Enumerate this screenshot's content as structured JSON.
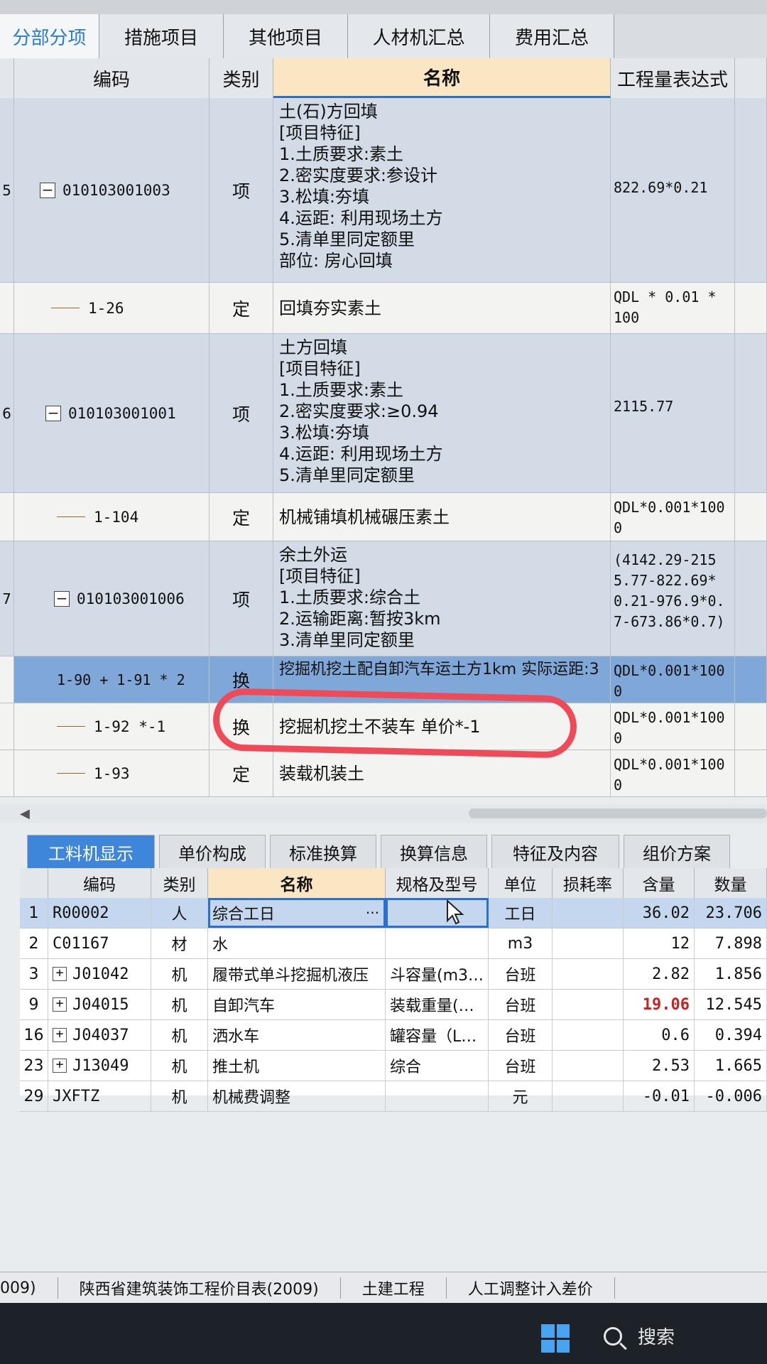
{
  "top_tabs": [
    "分部分项",
    "措施项目",
    "其他项目",
    "人材机汇总",
    "费用汇总"
  ],
  "grid_headers": {
    "code": "编码",
    "type": "类别",
    "name": "名称",
    "expr": "工程量表达式"
  },
  "rows": [
    {
      "num": "5",
      "code": "010103001003",
      "type": "项",
      "kind": "item",
      "name_lines": [
        "土(石)方回填",
        "[项目特征]",
        "1.土质要求:素土",
        "2.密实度要求:参设计",
        "3.松填:夯填",
        "4.运距: 利用现场土方",
        "5.清单里同定额里",
        "部位: 房心回填"
      ],
      "expr": "822.69*0.21"
    },
    {
      "num": "",
      "code": "1-26",
      "type": "定",
      "kind": "sub",
      "name_lines": [
        "回填夯实素土"
      ],
      "expr": "QDL * 0.01 * 100"
    },
    {
      "num": "6",
      "code": "010103001001",
      "type": "项",
      "kind": "item",
      "name_lines": [
        "土方回填",
        "[项目特征]",
        "1.土质要求:素土",
        "2.密实度要求:≥0.94",
        "3.松填:夯填",
        "4.运距: 利用现场土方",
        "5.清单里同定额里"
      ],
      "expr": "2115.77"
    },
    {
      "num": "",
      "code": "1-104",
      "type": "定",
      "kind": "sub",
      "name_lines": [
        "机械铺填机械碾压素土"
      ],
      "expr": "QDL*0.001*1000"
    },
    {
      "num": "7",
      "code": "010103001006",
      "type": "项",
      "kind": "item",
      "name_lines": [
        "余土外运",
        "[项目特征]",
        "1.土质要求:综合土",
        "2.运输距离:暂按3km",
        "3.清单里同定额里"
      ],
      "expr": "(4142.29-2155.77-822.69*0.21-976.9*0.7-673.86*0.7)"
    },
    {
      "num": "",
      "code": "1-90 + 1-91 * 2",
      "type": "换",
      "kind": "sel",
      "name_lines": [
        "挖掘机挖土配自卸汽车运土方1km  实际运距:3"
      ],
      "expr": "QDL*0.001*1000"
    },
    {
      "num": "",
      "code": "1-92 *-1",
      "type": "换",
      "kind": "sub",
      "name_lines": [
        "挖掘机挖土不装车  单价*-1"
      ],
      "expr": "QDL*0.001*1000"
    },
    {
      "num": "",
      "code": "1-93",
      "type": "定",
      "kind": "sub",
      "name_lines": [
        "装载机装土"
      ],
      "expr": "QDL*0.001*1000"
    }
  ],
  "bottom_tabs": [
    "工料机显示",
    "单价构成",
    "标准换算",
    "换算信息",
    "特征及内容",
    "组价方案"
  ],
  "res_headers": [
    "编码",
    "类别",
    "名称",
    "规格及型号",
    "单位",
    "损耗率",
    "含量",
    "数量"
  ],
  "resources": [
    {
      "num": "1",
      "code": "R00002",
      "plus": false,
      "type": "人",
      "name": "综合工日",
      "spec": "",
      "unit": "工日",
      "loss": "",
      "content": "36.02",
      "qty": "23.706",
      "selected": true
    },
    {
      "num": "2",
      "code": "C01167",
      "plus": false,
      "type": "材",
      "name": "水",
      "spec": "",
      "unit": "m3",
      "loss": "",
      "content": "12",
      "qty": "7.898",
      "selected": false
    },
    {
      "num": "3",
      "code": "J01042",
      "plus": true,
      "type": "机",
      "name": "履带式单斗挖掘机液压",
      "spec": "斗容量(m3…",
      "unit": "台班",
      "loss": "",
      "content": "2.82",
      "qty": "1.856",
      "selected": false
    },
    {
      "num": "9",
      "code": "J04015",
      "plus": true,
      "type": "机",
      "name": "自卸汽车",
      "spec": "装载重量(…",
      "unit": "台班",
      "loss": "",
      "content": "19.06",
      "qty": "12.545",
      "selected": false,
      "highlight": true
    },
    {
      "num": "16",
      "code": "J04037",
      "plus": true,
      "type": "机",
      "name": "洒水车",
      "spec": "罐容量（L…",
      "unit": "台班",
      "loss": "",
      "content": "0.6",
      "qty": "0.394",
      "selected": false
    },
    {
      "num": "23",
      "code": "J13049",
      "plus": true,
      "type": "机",
      "name": "推土机",
      "spec": "综合",
      "unit": "台班",
      "loss": "",
      "content": "2.53",
      "qty": "1.665",
      "selected": false
    },
    {
      "num": "29",
      "code": "JXFTZ",
      "plus": false,
      "type": "机",
      "name": "机械费调整",
      "spec": "",
      "unit": "元",
      "loss": "",
      "content": "-0.01",
      "qty": "-0.006",
      "selected": false
    }
  ],
  "ellipsis": "···",
  "status": [
    "009)",
    "陕西省建筑装饰工程价目表(2009)",
    "土建工程",
    "人工调整计入差价"
  ],
  "taskbar": {
    "search_label": "搜索"
  },
  "colors": {
    "accent": "#3d86d9",
    "annotation_circle": "#ee4a57",
    "highlight_red": "#c62424"
  }
}
